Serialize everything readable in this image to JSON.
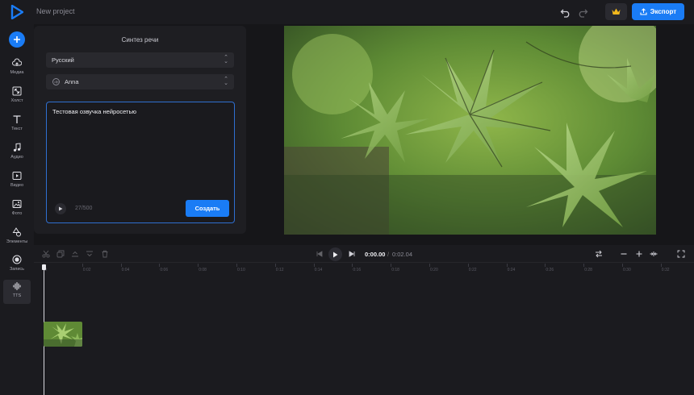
{
  "topbar": {
    "project_title": "New project",
    "export_label": "Экспорт"
  },
  "sidebar": {
    "items": [
      {
        "label": "Медиа",
        "icon": "cloud-upload-icon"
      },
      {
        "label": "Холст",
        "icon": "canvas-resize-icon"
      },
      {
        "label": "Текст",
        "icon": "text-t-icon"
      },
      {
        "label": "Аудио",
        "icon": "music-note-icon"
      },
      {
        "label": "Видео",
        "icon": "video-play-icon"
      },
      {
        "label": "Фото",
        "icon": "photo-icon"
      },
      {
        "label": "Элементы",
        "icon": "shapes-icon"
      },
      {
        "label": "Запись",
        "icon": "record-icon"
      },
      {
        "label": "TTS",
        "icon": "soundwave-icon",
        "active": true
      }
    ]
  },
  "tts": {
    "title": "Синтез речи",
    "language": "Русский",
    "voice": "Anna",
    "text": "Тестовая озвучка нейросетью",
    "char_count": "27/500",
    "create_label": "Создать"
  },
  "timeline": {
    "current_time": "0:00.00",
    "separator": "/",
    "total_time": "0:02.04",
    "ticks": [
      "0",
      "0:02",
      "0:04",
      "0:06",
      "0:08",
      "0:10",
      "0:12",
      "0:14",
      "0:16",
      "0:18",
      "0:20",
      "0:22",
      "0:24",
      "0:26",
      "0:28",
      "0:30",
      "0:32"
    ]
  },
  "colors": {
    "accent": "#1a7cf5",
    "background": "#161619",
    "panel": "#1e1e22"
  }
}
